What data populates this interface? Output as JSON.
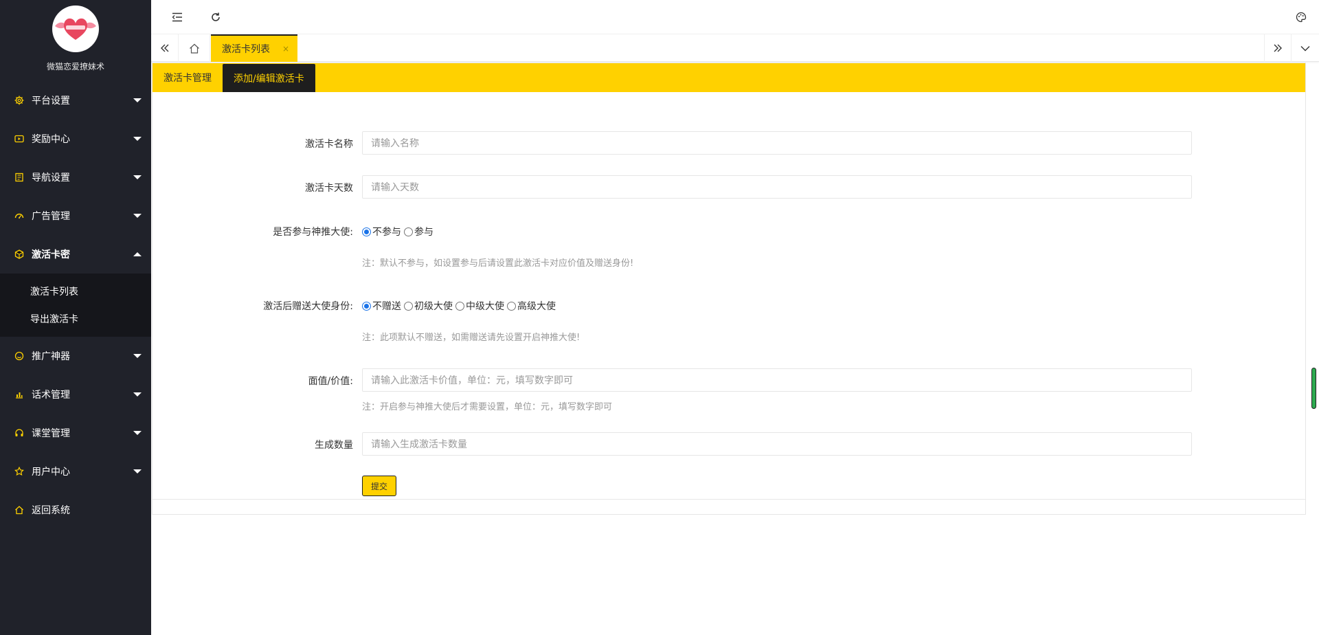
{
  "brand": {
    "name": "微猫恋爱撩妹术"
  },
  "sidebar": {
    "items": [
      {
        "label": "平台设置",
        "icon": "gear-icon"
      },
      {
        "label": "奖励中心",
        "icon": "video-icon"
      },
      {
        "label": "导航设置",
        "icon": "book-icon"
      },
      {
        "label": "广告管理",
        "icon": "dashboard-icon"
      },
      {
        "label": "激活卡密",
        "icon": "cube-icon",
        "expanded": true
      },
      {
        "label": "推广神器",
        "icon": "smile-icon"
      },
      {
        "label": "话术管理",
        "icon": "chart-icon"
      },
      {
        "label": "课堂管理",
        "icon": "headset-icon"
      },
      {
        "label": "用户中心",
        "icon": "star-icon"
      },
      {
        "label": "返回系统",
        "icon": "home-icon"
      }
    ],
    "sub_items": [
      "激活卡列表",
      "导出激活卡"
    ]
  },
  "tabs": {
    "active_label": "激活卡列表",
    "close": "×"
  },
  "subtabs": [
    "激活卡管理",
    "添加/编辑激活卡"
  ],
  "form": {
    "name_label": "激活卡名称",
    "name_placeholder": "请输入名称",
    "days_label": "激活卡天数",
    "days_placeholder": "请输入天数",
    "join_label": "是否参与神推大使:",
    "join_options": [
      "不参与",
      "参与"
    ],
    "join_selected": "不参与",
    "join_note": "注：默认不参与，如设置参与后请设置此激活卡对应价值及赠送身份!",
    "gift_label": "激活后赠送大使身份:",
    "gift_options": [
      "不赠送",
      "初级大使",
      "中级大使",
      "高级大使"
    ],
    "gift_selected": "不赠送",
    "gift_note": "注：此项默认不赠送，如需赠送请先设置开启神推大使!",
    "value_label": "面值/价值:",
    "value_placeholder": "请输入此激活卡价值，单位：元，填写数字即可",
    "value_note": "注：开启参与神推大使后才需要设置，单位：元，填写数字即可",
    "count_label": "生成数量",
    "count_placeholder": "请输入生成激活卡数量",
    "submit_label": "提交"
  },
  "colors": {
    "accent": "#ffd100",
    "sidebar_bg": "#20222a",
    "sub_bg": "#15161b",
    "dark": "#1e1e1e"
  }
}
